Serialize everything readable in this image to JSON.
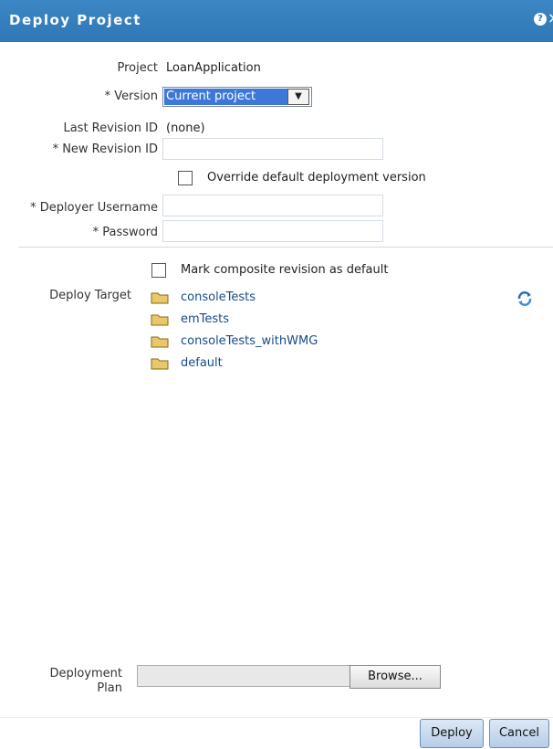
{
  "dialog": {
    "title": "Deploy Project",
    "help_glyph": "?",
    "close_glyph": "×"
  },
  "form": {
    "project_label": "Project",
    "project_value": "LoanApplication",
    "version_label": "* Version",
    "version_value": "Current project",
    "last_revision_label": "Last Revision ID",
    "last_revision_value": "(none)",
    "new_revision_label": "* New Revision ID",
    "new_revision_value": "",
    "override_label": "Override default deployment version",
    "override_checked": false,
    "username_label": "* Deployer Username",
    "username_value": "",
    "password_label": "* Password",
    "password_value": ""
  },
  "target": {
    "mark_default_label": "Mark composite revision as default",
    "mark_default_checked": false,
    "deploy_target_label": "Deploy Target",
    "folders": [
      "consoleTests",
      "emTests",
      "consoleTests_withWMG",
      "default"
    ],
    "refresh_icon": "refresh-icon"
  },
  "plan": {
    "label_line1": "Deployment",
    "label_line2": "Plan",
    "browse_label": "Browse..."
  },
  "buttons": {
    "deploy": "Deploy",
    "cancel": "Cancel"
  },
  "colors": {
    "titlebar": "#2f77b5",
    "selection": "#3d78d8",
    "link": "#1a4a8a"
  }
}
